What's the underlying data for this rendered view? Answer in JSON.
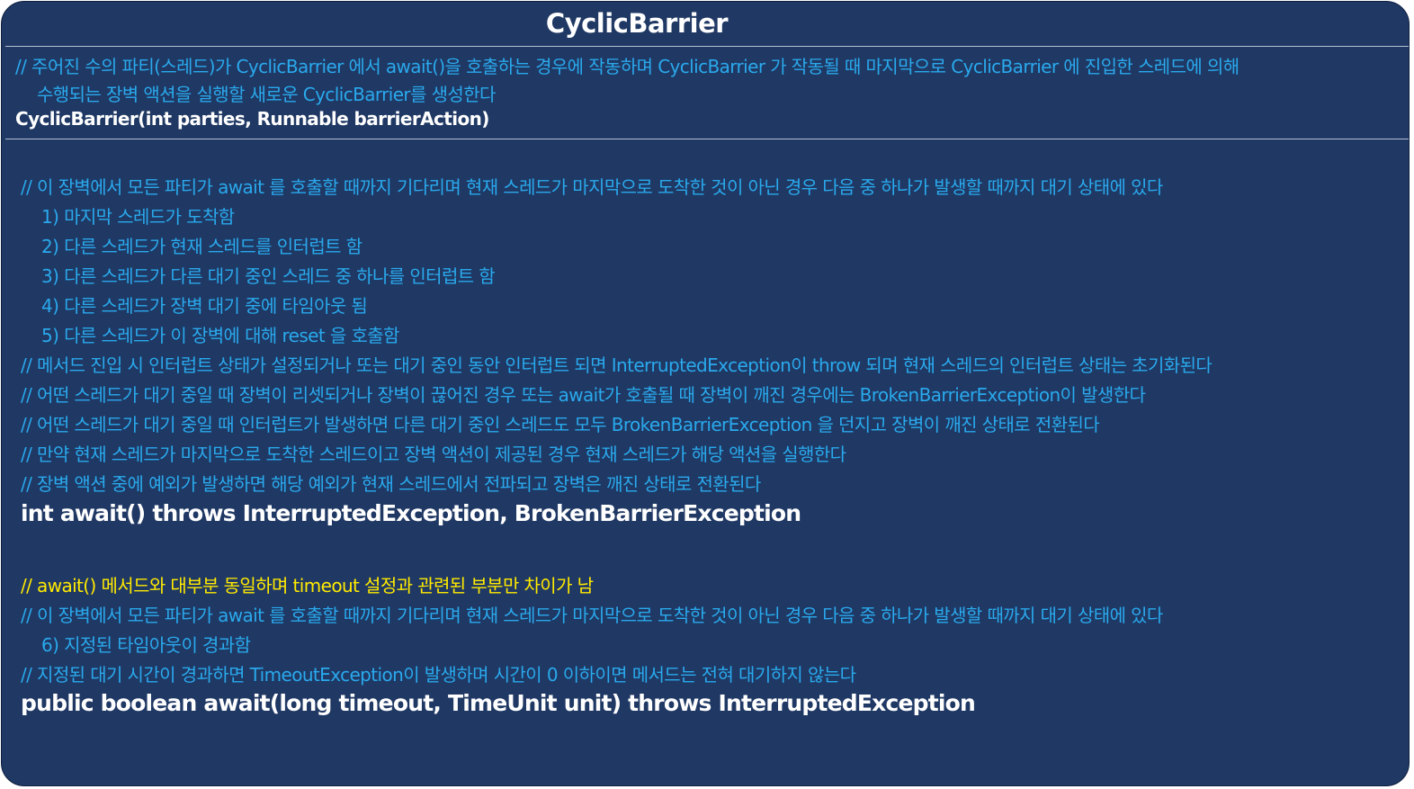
{
  "title": "CyclicBarrier",
  "constructor": {
    "comment_1": "// 주어진 수의 파티(스레드)가 CyclicBarrier 에서 await()을 호출하는 경우에 작동하며 CyclicBarrier 가 작동될 때 마지막으로 CyclicBarrier 에 진입한 스레드에 의해",
    "comment_2": "수행되는 장벽 액션을 실행할 새로운 CyclicBarrier를 생성한다",
    "signature": "CyclicBarrier(int parties, Runnable barrierAction)"
  },
  "await": {
    "comments": [
      "// 이 장벽에서 모든 파티가 await 를 호출할 때까지 기다리며 현재 스레드가 마지막으로 도착한 것이 아닌 경우 다음 중 하나가 발생할 때까지 대기 상태에 있다",
      "1) 마지막 스레드가 도착함",
      "2) 다른 스레드가 현재 스레드를 인터럽트 함",
      "3) 다른 스레드가 다른 대기 중인 스레드 중 하나를 인터럽트 함",
      "4) 다른 스레드가 장벽 대기 중에 타임아웃 됨",
      "5) 다른 스레드가 이 장벽에 대해 reset 을 호출함",
      "// 메서드 진입 시 인터럽트 상태가 설정되거나 또는 대기 중인 동안 인터럽트 되면 InterruptedException이 throw 되며 현재 스레드의 인터럽트 상태는 초기화된다",
      "// 어떤 스레드가 대기 중일 때 장벽이 리셋되거나 장벽이 끊어진 경우 또는 await가 호출될 때 장벽이 깨진 경우에는 BrokenBarrierException이 발생한다",
      "// 어떤 스레드가 대기 중일 때 인터럽트가 발생하면 다른 대기 중인 스레드도 모두 BrokenBarrierException 을 던지고 장벽이 깨진 상태로 전환된다",
      "// 만약 현재 스레드가 마지막으로 도착한 스레드이고 장벽 액션이 제공된 경우 현재 스레드가 해당 액션을 실행한다",
      "// 장벽 액션 중에 예외가 발생하면 해당 예외가 현재 스레드에서 전파되고 장벽은 깨진 상태로 전환된다"
    ],
    "signature": "int await() throws InterruptedException, BrokenBarrierException"
  },
  "await_timeout": {
    "highlight": "// await() 메서드와 대부분 동일하며 timeout 설정과 관련된 부분만 차이가 남",
    "comments": [
      "// 이 장벽에서 모든 파티가 await 를 호출할 때까지 기다리며 현재 스레드가 마지막으로 도착한 것이 아닌 경우 다음 중 하나가 발생할 때까지 대기 상태에 있다",
      "6) 지정된 타임아웃이 경과함",
      "// 지정된 대기 시간이 경과하면 TimeoutException이 발생하며 시간이 0 이하이면 메서드는 전혀 대기하지 않는다"
    ],
    "signature": "public boolean await(long timeout, TimeUnit unit) throws InterruptedException"
  },
  "colors": {
    "background": "#1f3864",
    "comment": "#2aa9ec",
    "highlight": "#ffea00",
    "signature": "#ffffff"
  }
}
